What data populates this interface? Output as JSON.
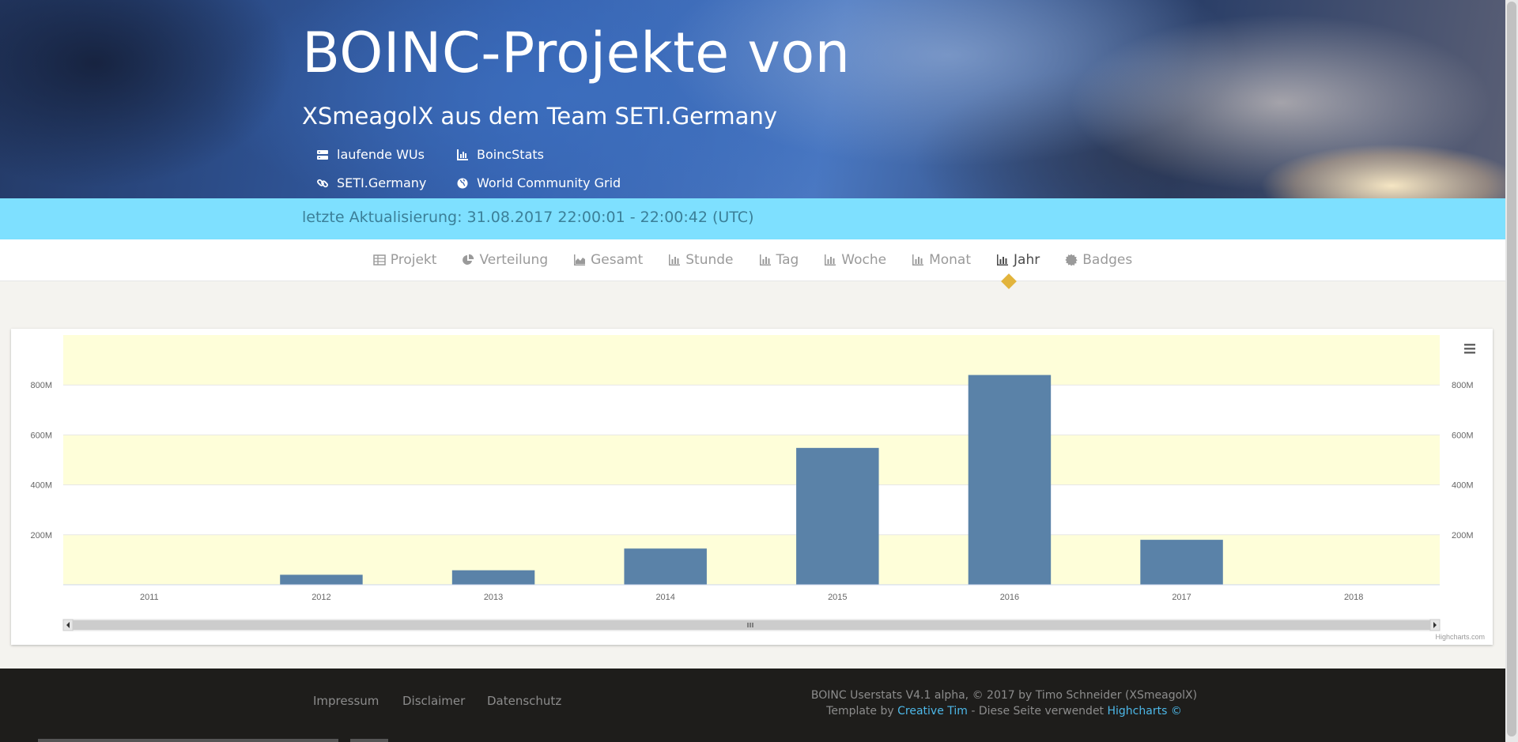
{
  "header": {
    "title": "BOINC-Projekte von",
    "subtitle": "XSmeagolX aus dem Team SETI.Germany",
    "links": [
      {
        "label": "laufende WUs",
        "icon": "server-icon"
      },
      {
        "label": "BoincStats",
        "icon": "bar-chart-icon"
      },
      {
        "label": "SETI.Germany",
        "icon": "link-icon"
      },
      {
        "label": "World Community Grid",
        "icon": "globe-icon"
      }
    ]
  },
  "update_bar": {
    "text": "letzte Aktualisierung: 31.08.2017 22:00:01 - 22:00:42 (UTC)"
  },
  "nav": {
    "items": [
      {
        "label": "Projekt",
        "icon": "table-icon"
      },
      {
        "label": "Verteilung",
        "icon": "pie-chart-icon"
      },
      {
        "label": "Gesamt",
        "icon": "area-chart-icon"
      },
      {
        "label": "Stunde",
        "icon": "bar-chart-icon"
      },
      {
        "label": "Tag",
        "icon": "bar-chart-icon"
      },
      {
        "label": "Woche",
        "icon": "bar-chart-icon"
      },
      {
        "label": "Monat",
        "icon": "bar-chart-icon"
      },
      {
        "label": "Jahr",
        "icon": "bar-chart-icon"
      },
      {
        "label": "Badges",
        "icon": "certificate-icon"
      }
    ],
    "active": "Jahr"
  },
  "chart_data": {
    "type": "bar",
    "categories": [
      "2011",
      "2012",
      "2013",
      "2014",
      "2015",
      "2016",
      "2017",
      "2018"
    ],
    "values": [
      0,
      40000000,
      58000000,
      145000000,
      548000000,
      840000000,
      180000000,
      0
    ],
    "ylim": [
      0,
      1000000000
    ],
    "yticks": [
      200000000,
      400000000,
      600000000,
      800000000
    ],
    "ytick_labels": [
      "200M",
      "400M",
      "600M",
      "800M"
    ],
    "y_axis_sides": "left and right",
    "grid": true,
    "plot_bands": "alternating light yellow",
    "bar_color": "#5a82a8",
    "band_color": "#fefed9",
    "credit": "Highcharts.com",
    "menu_icon": "hamburger-menu-icon",
    "has_navigator_scrollbar": true
  },
  "footer": {
    "links": [
      "Impressum",
      "Disclaimer",
      "Datenschutz"
    ],
    "line1": "BOINC Userstats V4.1 alpha, © 2017 by Timo Schneider (XSmeagolX)",
    "line2_prefix": "Template by",
    "line2_link1": "Creative Tim",
    "line2_middle": "- Diese Seite verwendet",
    "line2_link2": "Highcharts ©",
    "link_color": "#4db8e8"
  }
}
